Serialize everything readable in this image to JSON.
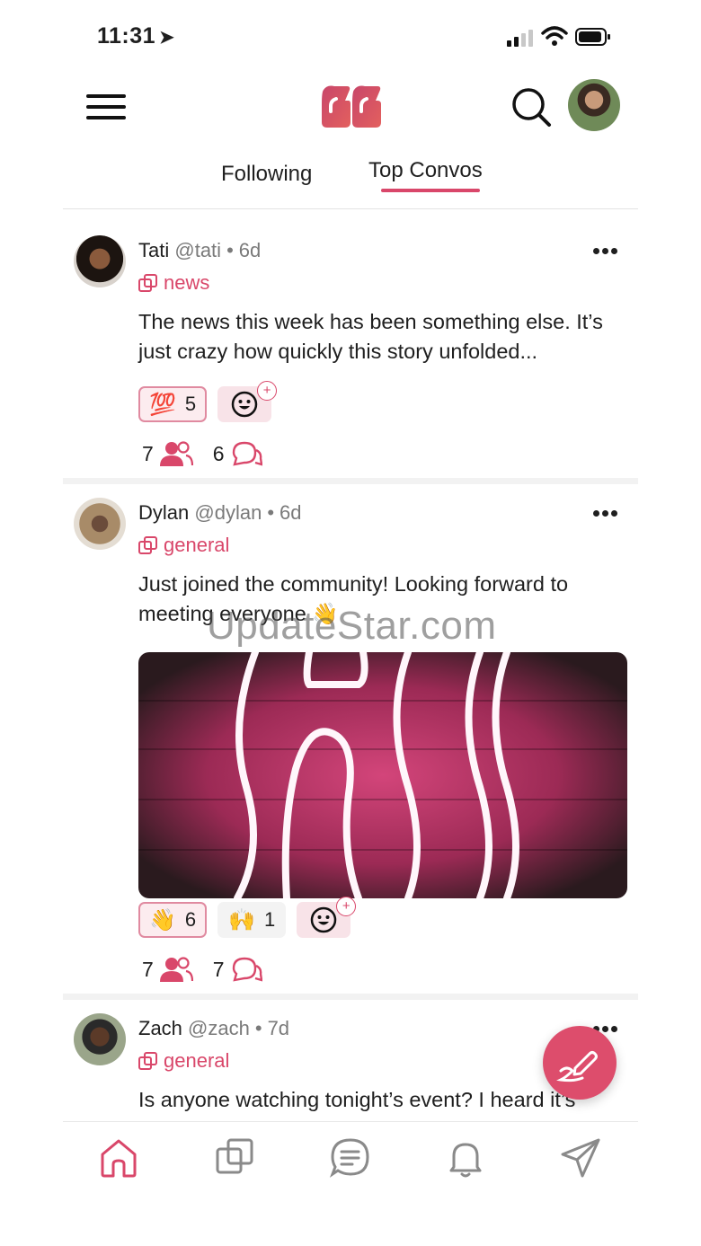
{
  "status_bar": {
    "time": "11:31"
  },
  "header": {
    "logo_icon": "quote-logo-icon",
    "accent_color": "#d9476a"
  },
  "tabs": [
    {
      "label": "Following",
      "active": false
    },
    {
      "label": "Top Convos",
      "active": true
    }
  ],
  "posts": [
    {
      "name": "Tati",
      "handle": "@tati",
      "time": "6d",
      "channel": "news",
      "text": "The news this week has been something else. It’s just crazy how quickly this story unfolded...",
      "reactions": [
        {
          "emoji": "💯",
          "count": "5",
          "mine": true
        }
      ],
      "participants": "7",
      "replies": "6"
    },
    {
      "name": "Dylan",
      "handle": "@dylan",
      "time": "6d",
      "channel": "general",
      "text": "Just joined the community! Looking forward to meeting everyone 👋",
      "image": "neon-hi-sign",
      "reactions": [
        {
          "emoji": "👋",
          "count": "6",
          "mine": true
        },
        {
          "emoji": "🙌",
          "count": "1",
          "mine": false
        }
      ],
      "participants": "7",
      "replies": "7"
    },
    {
      "name": "Zach",
      "handle": "@zach",
      "time": "7d",
      "channel": "general",
      "text": "Is anyone watching tonight’s event? I heard it’s"
    }
  ],
  "watermark": "UpdateStar.com",
  "bottom_nav": [
    "home-icon",
    "channels-icon",
    "messages-icon",
    "bell-icon",
    "send-icon"
  ]
}
